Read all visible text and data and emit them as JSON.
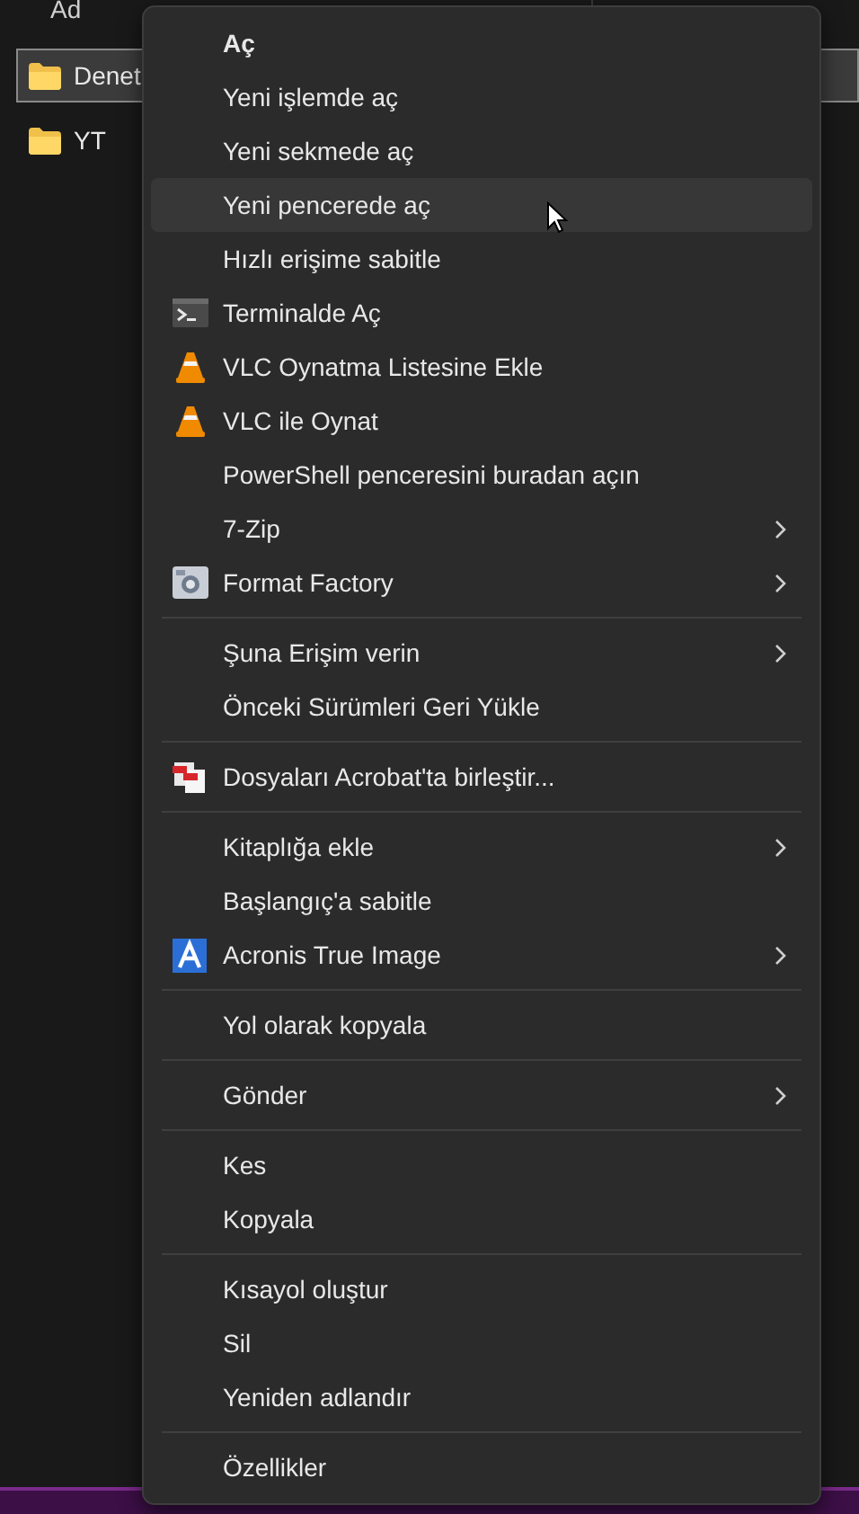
{
  "explorer": {
    "column_header": "Ad",
    "rows": [
      {
        "name": "Denet",
        "selected": true
      },
      {
        "name": "YT",
        "selected": false
      }
    ]
  },
  "context_menu": {
    "sections": [
      [
        {
          "label": "Aç",
          "default": true,
          "hovered": false,
          "submenu": false,
          "kind": "plain"
        },
        {
          "label": "Yeni işlemde aç",
          "default": false,
          "hovered": false,
          "submenu": false,
          "kind": "plain"
        },
        {
          "label": "Yeni sekmede aç",
          "default": false,
          "hovered": false,
          "submenu": false,
          "kind": "plain"
        },
        {
          "label": "Yeni pencerede aç",
          "default": false,
          "hovered": true,
          "submenu": false,
          "kind": "plain"
        },
        {
          "label": "Hızlı erişime sabitle",
          "default": false,
          "hovered": false,
          "submenu": false,
          "kind": "plain"
        },
        {
          "label": "Terminalde Aç",
          "default": false,
          "hovered": false,
          "submenu": false,
          "kind": "terminal"
        },
        {
          "label": "VLC Oynatma Listesine Ekle",
          "default": false,
          "hovered": false,
          "submenu": false,
          "kind": "cone"
        },
        {
          "label": "VLC ile Oynat",
          "default": false,
          "hovered": false,
          "submenu": false,
          "kind": "cone"
        },
        {
          "label": "PowerShell penceresini buradan açın",
          "default": false,
          "hovered": false,
          "submenu": false,
          "kind": "plain"
        },
        {
          "label": "7-Zip",
          "default": false,
          "hovered": false,
          "submenu": true,
          "kind": "plain"
        },
        {
          "label": "Format Factory",
          "default": false,
          "hovered": false,
          "submenu": true,
          "kind": "app"
        }
      ],
      [
        {
          "label": "Şuna Erişim verin",
          "default": false,
          "hovered": false,
          "submenu": true,
          "kind": "plain"
        },
        {
          "label": "Önceki Sürümleri Geri Yükle",
          "default": false,
          "hovered": false,
          "submenu": false,
          "kind": "plain"
        }
      ],
      [
        {
          "label": "Dosyaları Acrobat'ta birleştir...",
          "default": false,
          "hovered": false,
          "submenu": false,
          "kind": "documents"
        }
      ],
      [
        {
          "label": "Kitaplığa ekle",
          "default": false,
          "hovered": false,
          "submenu": true,
          "kind": "plain"
        },
        {
          "label": "Başlangıç'a sabitle",
          "default": false,
          "hovered": false,
          "submenu": false,
          "kind": "plain"
        },
        {
          "label": "Acronis True Image",
          "default": false,
          "hovered": false,
          "submenu": true,
          "kind": "letter"
        }
      ],
      [
        {
          "label": "Yol olarak kopyala",
          "default": false,
          "hovered": false,
          "submenu": false,
          "kind": "plain"
        }
      ],
      [
        {
          "label": "Gönder",
          "default": false,
          "hovered": false,
          "submenu": true,
          "kind": "plain"
        }
      ],
      [
        {
          "label": "Kes",
          "default": false,
          "hovered": false,
          "submenu": false,
          "kind": "plain"
        },
        {
          "label": "Kopyala",
          "default": false,
          "hovered": false,
          "submenu": false,
          "kind": "plain"
        }
      ],
      [
        {
          "label": "Kısayol oluştur",
          "default": false,
          "hovered": false,
          "submenu": false,
          "kind": "plain"
        },
        {
          "label": "Sil",
          "default": false,
          "hovered": false,
          "submenu": false,
          "kind": "plain"
        },
        {
          "label": "Yeniden adlandır",
          "default": false,
          "hovered": false,
          "submenu": false,
          "kind": "plain"
        }
      ],
      [
        {
          "label": "Özellikler",
          "default": false,
          "hovered": false,
          "submenu": false,
          "kind": "plain"
        }
      ]
    ]
  }
}
